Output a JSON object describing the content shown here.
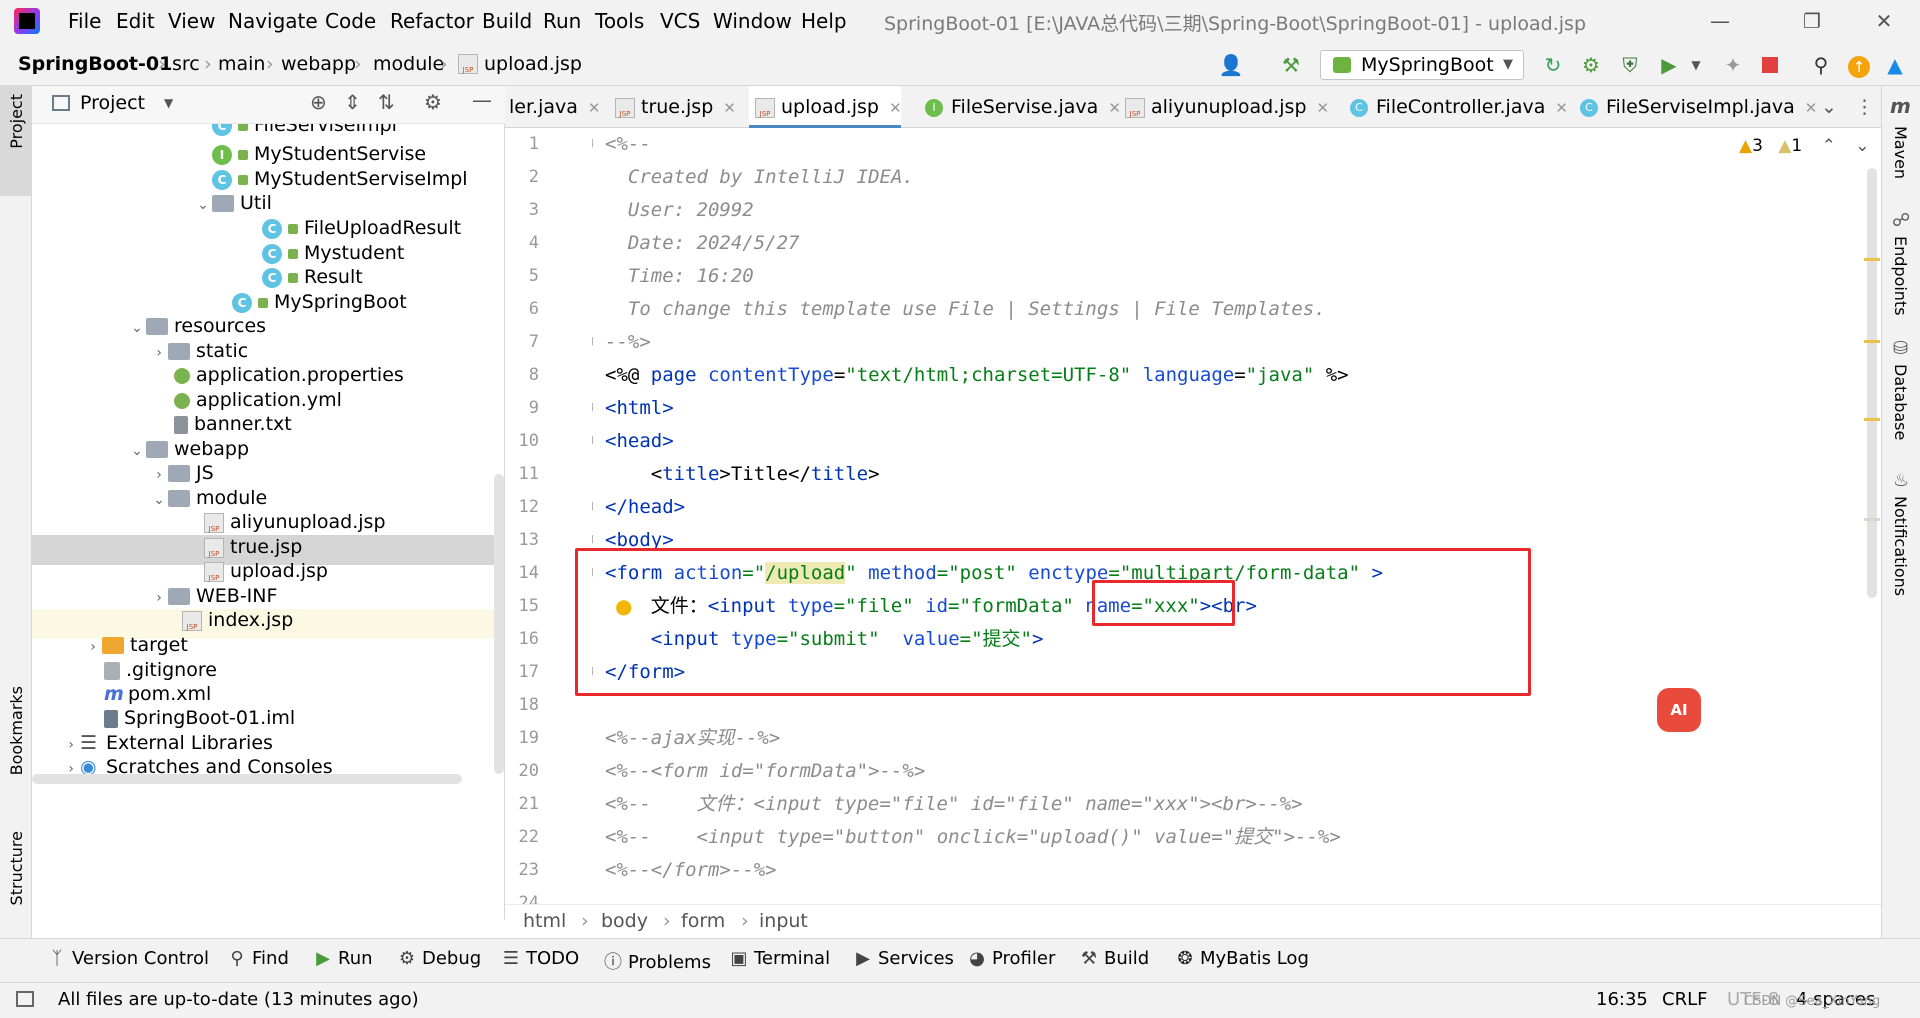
{
  "titlebar": {
    "menus": [
      "File",
      "Edit",
      "View",
      "Navigate",
      "Code",
      "Refactor",
      "Build",
      "Run",
      "Tools",
      "VCS",
      "Window",
      "Help"
    ],
    "window_title": "SpringBoot-01 [E:\\JAVA总代码\\三期\\Spring-Boot\\SpringBoot-01] - upload.jsp"
  },
  "navbar": {
    "crumbs": [
      "SpringBoot-01",
      "src",
      "main",
      "webapp",
      "module",
      "upload.jsp"
    ],
    "run_config": "MySpringBoot"
  },
  "project": {
    "title": "Project",
    "items": [
      {
        "label": "FileServiseImpl",
        "icon": "class-icon"
      },
      {
        "label": "MyStudentServise",
        "icon": "interface-icon"
      },
      {
        "label": "MyStudentServiseImpl",
        "icon": "class-icon"
      },
      {
        "label": "Util",
        "icon": "folder-icon"
      },
      {
        "label": "FileUploadResult",
        "icon": "class-icon"
      },
      {
        "label": "Mystudent",
        "icon": "class-icon"
      },
      {
        "label": "Result",
        "icon": "class-icon"
      },
      {
        "label": "MySpringBoot",
        "icon": "springboot-class-icon"
      },
      {
        "label": "resources",
        "icon": "folder-icon"
      },
      {
        "label": "static",
        "icon": "folder-icon"
      },
      {
        "label": "application.properties",
        "icon": "properties-icon"
      },
      {
        "label": "application.yml",
        "icon": "yml-icon"
      },
      {
        "label": "banner.txt",
        "icon": "text-file-icon"
      },
      {
        "label": "webapp",
        "icon": "folder-icon"
      },
      {
        "label": "JS",
        "icon": "folder-icon"
      },
      {
        "label": "module",
        "icon": "folder-icon"
      },
      {
        "label": "aliyunupload.jsp",
        "icon": "jsp-icon"
      },
      {
        "label": "true.jsp",
        "icon": "jsp-icon"
      },
      {
        "label": "upload.jsp",
        "icon": "jsp-icon"
      },
      {
        "label": "WEB-INF",
        "icon": "folder-icon"
      },
      {
        "label": "index.jsp",
        "icon": "jsp-icon"
      },
      {
        "label": "target",
        "icon": "folder-icon"
      },
      {
        "label": ".gitignore",
        "icon": "gitignore-icon"
      },
      {
        "label": "pom.xml",
        "icon": "maven-icon"
      },
      {
        "label": "SpringBoot-01.iml",
        "icon": "iml-icon"
      },
      {
        "label": "External Libraries",
        "icon": "library-icon"
      },
      {
        "label": "Scratches and Consoles",
        "icon": "scratch-icon"
      }
    ]
  },
  "tabs": [
    "ler.java",
    "true.jsp",
    "upload.jsp",
    "FileServise.java",
    "aliyunupload.jsp",
    "FileController.java",
    "FileServiseImpl.java"
  ],
  "editor": {
    "inspections": {
      "warnings": "3",
      "weak_warnings": "1"
    },
    "line_numbers": [
      "1",
      "2",
      "3",
      "4",
      "5",
      "6",
      "7",
      "8",
      "9",
      "10",
      "11",
      "12",
      "13",
      "14",
      "15",
      "16",
      "17",
      "18",
      "19",
      "20",
      "21",
      "22",
      "23",
      "24"
    ],
    "lines": {
      "l1": "<%--",
      "l2": "  Created by IntelliJ IDEA.",
      "l3": "  User: 20992",
      "l4": "  Date: 2024/5/27",
      "l5": "  Time: 16:20",
      "l6": "  To change this template use File | Settings | File Templates.",
      "l7": "--%>",
      "l8a": "<%@ ",
      "l8b": "page ",
      "l8c": "contentType",
      "l8d": "=",
      "l8e": "\"text/html;charset=UTF-8\"",
      "l8f": " language",
      "l8g": "=",
      "l8h": "\"java\"",
      "l8i": " %>",
      "l9": "<html>",
      "l10": "<head>",
      "l11a": "    <",
      "l11b": "title",
      "l11c": ">Title</",
      "l11d": "title",
      "l11e": ">",
      "l12": "</head>",
      "l13": "<body>",
      "l14a": "<form ",
      "l14b": "action",
      "l14c": "=\"",
      "l14d": "/upload",
      "l14e": "\"",
      "l14f": " method",
      "l14g": "=\"post\"",
      "l14h": " enctype",
      "l14i": "=\"multipart/form-data\"",
      "l14j": " >",
      "l15a": "    文件：",
      "l15b": "<input ",
      "l15c": "type",
      "l15d": "=\"file\"",
      "l15e": " id",
      "l15f": "=\"formData\"",
      "l15g": " name",
      "l15h": "=\"xxx\"",
      "l15i": "><br>",
      "l16a": "    <input ",
      "l16b": "type",
      "l16c": "=\"submit\"",
      "l16d": "  value",
      "l16e": "=\"提交\"",
      "l16f": ">",
      "l17": "</form>",
      "l18": "",
      "l19": "<%--ajax实现--%>",
      "l20": "<%--<form id=\"formData\">--%>",
      "l21": "<%--    文件：<input type=\"file\" id=\"file\" name=\"xxx\"><br>--%>",
      "l22": "<%--    <input type=\"button\" onclick=\"upload()\" value=\"提交\">--%>",
      "l23": "<%--</form>--%>"
    },
    "breadcrumb": [
      "html",
      "body",
      "form",
      "input"
    ]
  },
  "right_tools": [
    "Maven",
    "Endpoints",
    "Database",
    "Notifications"
  ],
  "left_tools": [
    "Project",
    "Bookmarks",
    "Structure"
  ],
  "bottom_tools": [
    "Version Control",
    "Find",
    "Run",
    "Debug",
    "TODO",
    "Problems",
    "Terminal",
    "Services",
    "Profiler",
    "Build",
    "MyBatis Log"
  ],
  "status": {
    "message": "All files are up-to-date (13 minutes ago)",
    "time": "16:35",
    "line_sep": "CRLF",
    "encoding": "UTF-8",
    "indent": "4 spaces",
    "watermark": "CSDN @Sea_XinYang"
  },
  "ai_button": "AI"
}
